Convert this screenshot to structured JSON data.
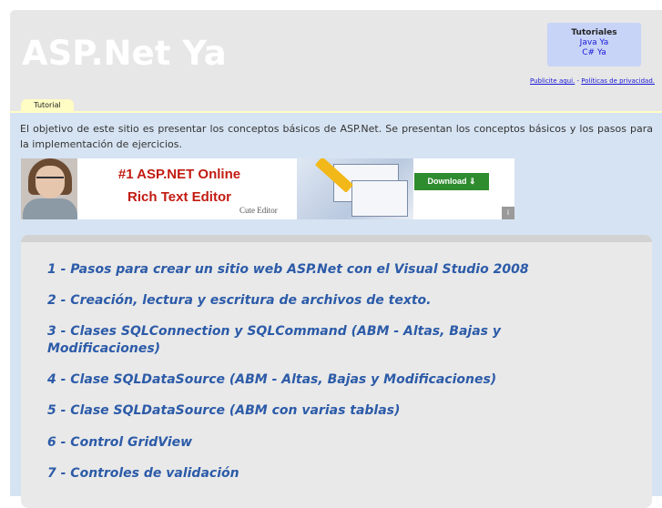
{
  "header": {
    "title": "ASP.Net Ya",
    "tutorials": {
      "title": "Tutoriales",
      "links": [
        "Java Ya",
        "C# Ya"
      ]
    },
    "links": [
      "Publicite aqui.",
      "Políticas de privacidad."
    ],
    "tab_label": "Tutorial"
  },
  "intro_text": "El objetivo de este sitio es presentar los conceptos básicos de ASP.Net. Se presentan los conceptos básicos y los pasos para la implementación de ejercicios.",
  "banner": {
    "headline_1": "#1 ASP.NET Online",
    "headline_2": "Rich Text Editor",
    "brand": "Cute Editor",
    "download_label": "Download ⇓"
  },
  "topics": [
    "1 - Pasos para crear un sitio web ASP.Net con el Visual Studio 2008",
    "2 - Creación, lectura y escritura de archivos de texto.",
    "3 - Clases SQLConnection y SQLCommand (ABM - Altas, Bajas y Modificaciones)",
    "4 - Clase SQLDataSource (ABM - Altas, Bajas y Modificaciones)",
    "5 - Clase SQLDataSource (ABM con varias tablas)",
    "6 - Control GridView",
    "7 - Controles de validación"
  ],
  "colors": {
    "link": "#2c5ba8",
    "banner_headline": "#c21b12",
    "tab": "#fffcc4"
  }
}
